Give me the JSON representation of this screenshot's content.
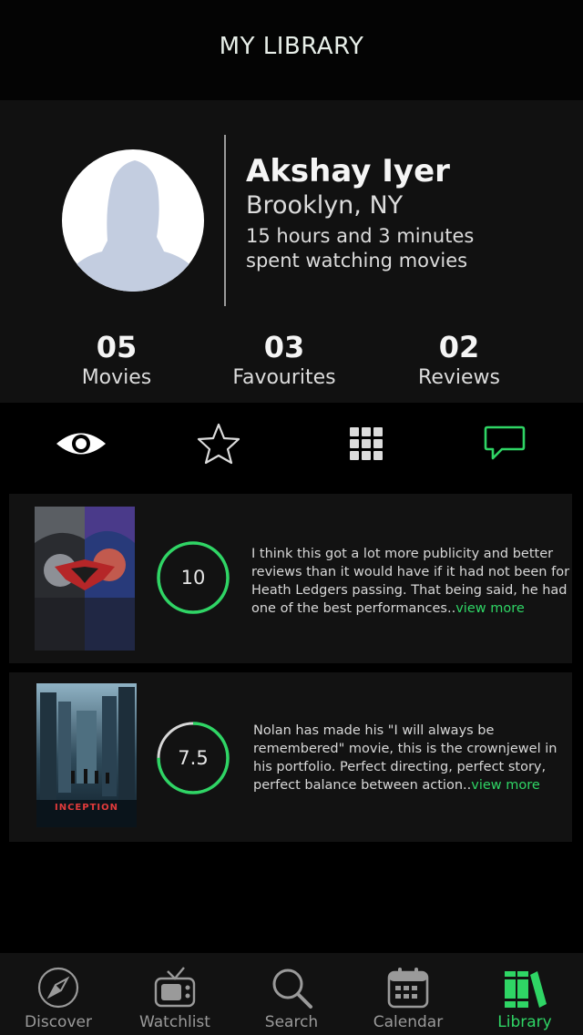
{
  "header": {
    "title": "MY LIBRARY"
  },
  "profile": {
    "name": "Akshay Iyer",
    "location": "Brooklyn, NY",
    "watch_time_line1": "15 hours and 3 minutes",
    "watch_time_line2": "spent watching movies"
  },
  "stats": [
    {
      "value": "05",
      "label": "Movies"
    },
    {
      "value": "03",
      "label": "Favourites"
    },
    {
      "value": "02",
      "label": "Reviews"
    }
  ],
  "tabs": [
    {
      "icon": "eye-icon",
      "active": false
    },
    {
      "icon": "star-icon",
      "active": false
    },
    {
      "icon": "grid-icon",
      "active": false
    },
    {
      "icon": "chat-bubble-icon",
      "active": true
    }
  ],
  "reviews": [
    {
      "score": "10",
      "score_fraction": 1.0,
      "text": "I think this got a lot more publicity and better reviews than it would have if it had not been for Heath Ledgers passing. That being said, he had one of the best performances..",
      "view_more": "view more"
    },
    {
      "score": "7.5",
      "score_fraction": 0.75,
      "text": "Nolan has made his \"I will always be remembered\" movie, this is the crownjewel in his portfolio. Perfect directing, perfect story, perfect balance between action..",
      "view_more": "view more",
      "poster_title": "INCEPTION"
    }
  ],
  "tabbar": [
    {
      "label": "Discover",
      "icon": "compass-icon",
      "active": false
    },
    {
      "label": "Watchlist",
      "icon": "tv-icon",
      "active": false
    },
    {
      "label": "Search",
      "icon": "search-icon",
      "active": false
    },
    {
      "label": "Calendar",
      "icon": "calendar-icon",
      "active": false
    },
    {
      "label": "Library",
      "icon": "books-icon",
      "active": true
    }
  ],
  "colors": {
    "accent": "#2fd565",
    "background": "#000000",
    "card": "#121212",
    "ring_track": "#d8d8d8"
  }
}
